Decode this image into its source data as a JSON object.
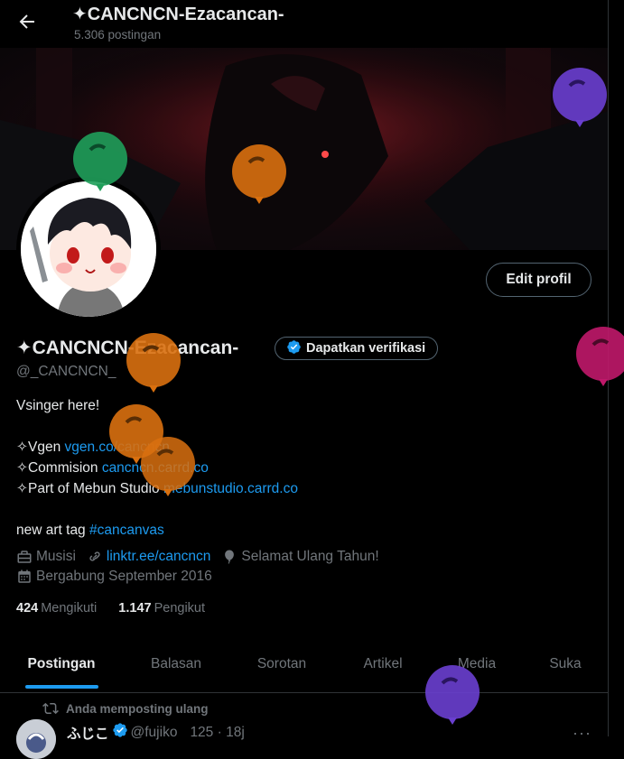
{
  "header": {
    "title": "✦CANCNCN-Ezacancan-",
    "post_count": "5.306 postingan"
  },
  "profile": {
    "name": "✦CANCNCN-Ezacancan-",
    "verify_label": "Dapatkan verifikasi",
    "handle": "@_CANCNCN_",
    "edit_label": "Edit profil",
    "bio": {
      "line1": "Vsinger here!",
      "vgen_prefix": "✧Vgen ",
      "vgen_link": "vgen.co/cancncn",
      "commision_prefix": "✧Commision ",
      "commision_link": "cancncn.carrd.co",
      "studio_prefix": "✧Part of Mebun Studio ",
      "studio_link": "mebunstudio.carrd.co",
      "art_prefix": "new art tag ",
      "art_tag": "#cancanvas"
    },
    "category": "Musisi",
    "website": "linktr.ee/cancncn",
    "birthday": "Selamat Ulang Tahun!",
    "joined": "Bergabung September 2016",
    "following_count": "424",
    "following_label": "Mengikuti",
    "followers_count": "1.147",
    "followers_label": "Pengikut"
  },
  "tabs": [
    {
      "label": "Postingan"
    },
    {
      "label": "Balasan"
    },
    {
      "label": "Sorotan"
    },
    {
      "label": "Artikel"
    },
    {
      "label": "Media"
    },
    {
      "label": "Suka"
    }
  ],
  "active_tab": "Postingan",
  "post": {
    "repost_label": "Anda memposting ulang",
    "author_name": "ふじこ",
    "author_handle": "@fujiko",
    "author_meta": "125 · 18j",
    "more": "···"
  },
  "colors": {
    "accent": "#1d9bf0",
    "balloon_orange": "#d9700f",
    "balloon_purple": "#6a3fd0",
    "balloon_green": "#1f9f5a",
    "balloon_magenta": "#c0186a"
  },
  "icons": [
    "back-arrow-icon",
    "verified-badge-icon",
    "briefcase-icon",
    "link-icon",
    "balloon-icon",
    "calendar-icon",
    "repost-icon",
    "more-icon"
  ]
}
